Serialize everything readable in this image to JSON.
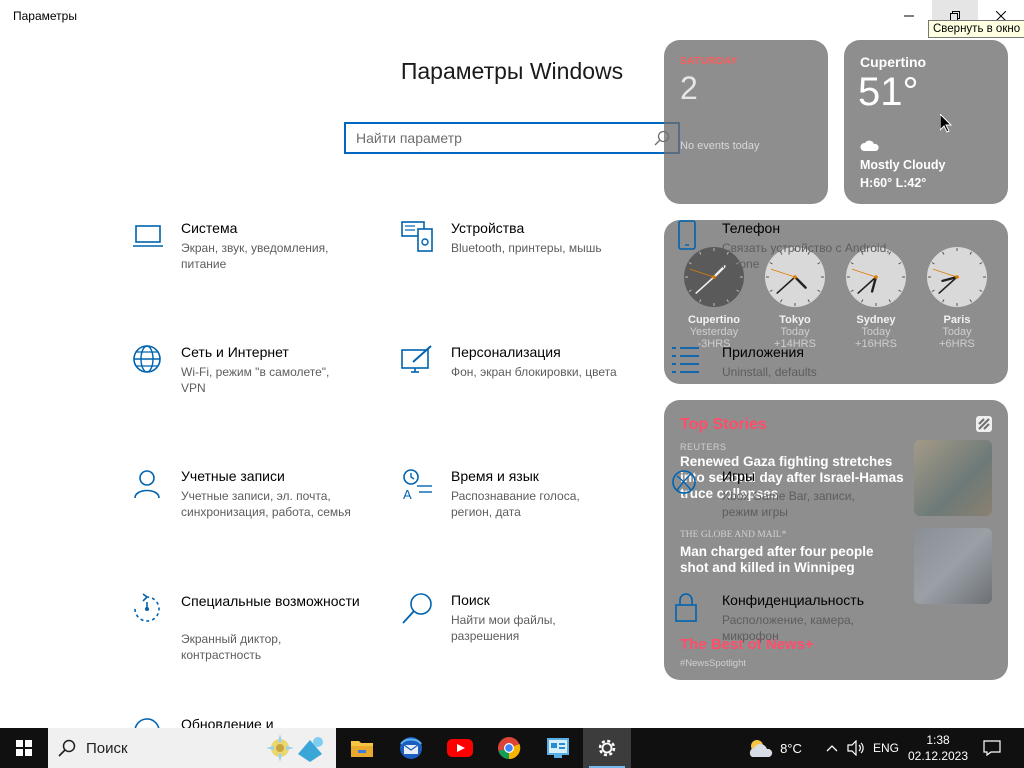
{
  "window": {
    "title": "Параметры",
    "tooltip": "Свернуть в окно"
  },
  "page": {
    "title": "Параметры Windows",
    "search_placeholder": "Найти параметр"
  },
  "categories": [
    {
      "name": "Система",
      "desc": "Экран, звук, уведомления, питание",
      "icon": "laptop-icon"
    },
    {
      "name": "Устройства",
      "desc": "Bluetooth, принтеры, мышь",
      "icon": "devices-icon"
    },
    {
      "name": "Телефон",
      "desc": "Связать устройство с Android, iPhone",
      "icon": "phone-icon"
    },
    {
      "name": "Сеть и Интернет",
      "desc": "Wi-Fi, режим \"в самолете\", VPN",
      "icon": "globe-icon"
    },
    {
      "name": "Персонализация",
      "desc": "Фон, экран блокировки, цвета",
      "icon": "paint-icon"
    },
    {
      "name": "Приложения",
      "desc": "Uninstall, defaults",
      "icon": "apps-list-icon"
    },
    {
      "name": "Учетные записи",
      "desc": "Учетные записи, эл. почта, синхронизация, работа, семья",
      "icon": "person-icon"
    },
    {
      "name": "Время и язык",
      "desc": "Распознавание голоса, регион, дата",
      "icon": "time-language-icon"
    },
    {
      "name": "Игры",
      "desc": "Xbox Game Bar, записи, режим игры",
      "icon": "xbox-icon"
    },
    {
      "name": "Специальные возможности",
      "desc": "Экранный диктор, контрастность",
      "icon": "accessibility-icon"
    },
    {
      "name": "Поиск",
      "desc": "Найти мои файлы, разрешения",
      "icon": "search-icon"
    },
    {
      "name": "Конфиденциальность",
      "desc": "Расположение, камера, микрофон",
      "icon": "lock-icon"
    },
    {
      "name": "Обновление и",
      "desc": "",
      "icon": "update-icon"
    }
  ],
  "widgets": {
    "calendar": {
      "dow": "SATURDAY",
      "day": "2",
      "events": "No events today"
    },
    "weather": {
      "city": "Cupertino",
      "temp": "51°",
      "condition": "Mostly Cloudy",
      "hilo": "H:60° L:42°"
    },
    "clocks": [
      {
        "city": "Cupertino",
        "day": "Yesterday",
        "offset": "-3HRS",
        "hour": 1.5,
        "minute": 38
      },
      {
        "city": "Tokyo",
        "day": "Today",
        "offset": "+14HRS",
        "hour": 4.5,
        "minute": 38
      },
      {
        "city": "Sydney",
        "day": "Today",
        "offset": "+16HRS",
        "hour": 6.5,
        "minute": 38
      },
      {
        "city": "Paris",
        "day": "Today",
        "offset": "+6HRS",
        "hour": 8.5,
        "minute": 38
      }
    ],
    "news": {
      "heading": "Top Stories",
      "source1": "REUTERS",
      "headline1": "Renewed Gaza fighting stretches into second day after Israel-Hamas truce collapses",
      "source2": "THE GLOBE AND MAIL*",
      "headline2": "Man charged after four people shot and killed in Winnipeg",
      "best": "The Best of News+",
      "spotlight": "#NewsSpotlight"
    }
  },
  "taskbar": {
    "search_label": "Поиск",
    "apps": [
      "file-explorer",
      "thunderbird",
      "youtube",
      "chrome",
      "control-panel",
      "settings"
    ],
    "weather_temp": "8°C",
    "language": "ENG",
    "time": "1:38",
    "date": "02.12.2023"
  },
  "colors": {
    "accent": "#0067c0",
    "icon_blue": "#0063b1",
    "taskbar": "#101010",
    "widget_bg": "#6e6e6e",
    "news_red": "#ff4d6a"
  }
}
